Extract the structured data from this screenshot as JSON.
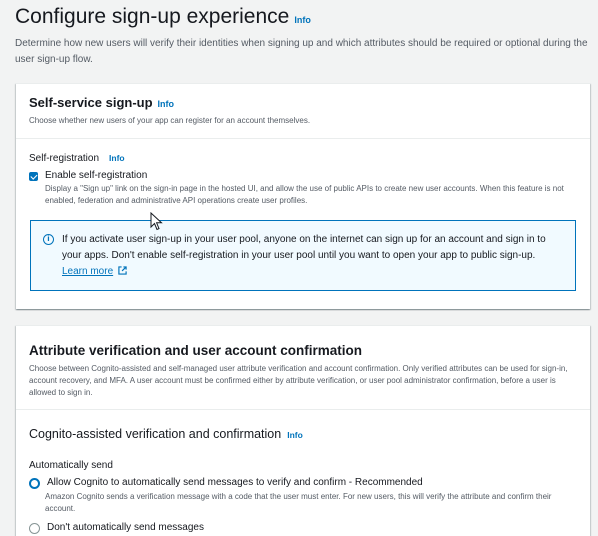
{
  "header": {
    "title": "Configure sign-up experience",
    "info": "Info",
    "description": "Determine how new users will verify their identities when signing up and which attributes should be required or optional during the user sign-up flow."
  },
  "self_service": {
    "title": "Self-service sign-up",
    "info": "Info",
    "subtitle": "Choose whether new users of your app can register for an account themselves.",
    "field_label": "Self-registration",
    "field_info": "Info",
    "checkbox_label": "Enable self-registration",
    "checkbox_checked": true,
    "checkbox_desc": "Display a \"Sign up\" link on the sign-in page in the hosted UI, and allow the use of public APIs to create new user accounts. When this feature is not enabled, federation and administrative API operations create user profiles.",
    "alert_text": "If you activate user sign-up in your user pool, anyone on the internet can sign up for an account and sign in to your apps. Don't enable self-registration in your user pool until you want to open your app to public sign-up.",
    "alert_link": "Learn more"
  },
  "attribute_verification": {
    "title": "Attribute verification and user account confirmation",
    "subtitle": "Choose between Cognito-assisted and self-managed user attribute verification and account confirmation. Only verified attributes can be used for sign-in, account recovery, and MFA. A user account must be confirmed either by attribute verification, or user pool administrator confirmation, before a user is allowed to sign in.",
    "section_title": "Cognito-assisted verification and confirmation",
    "section_info": "Info",
    "auto_send_label": "Automatically send",
    "options": [
      {
        "label": "Allow Cognito to automatically send messages to verify and confirm - Recommended",
        "desc": "Amazon Cognito sends a verification message with a code that the user must enter. For new users, this will verify the attribute and confirm their account.",
        "selected": true
      },
      {
        "label": "Don't automatically send messages",
        "selected": false
      }
    ]
  },
  "colors": {
    "accent": "#0073bb",
    "background": "#f2f3f3",
    "alert_bg": "#f1faff"
  }
}
